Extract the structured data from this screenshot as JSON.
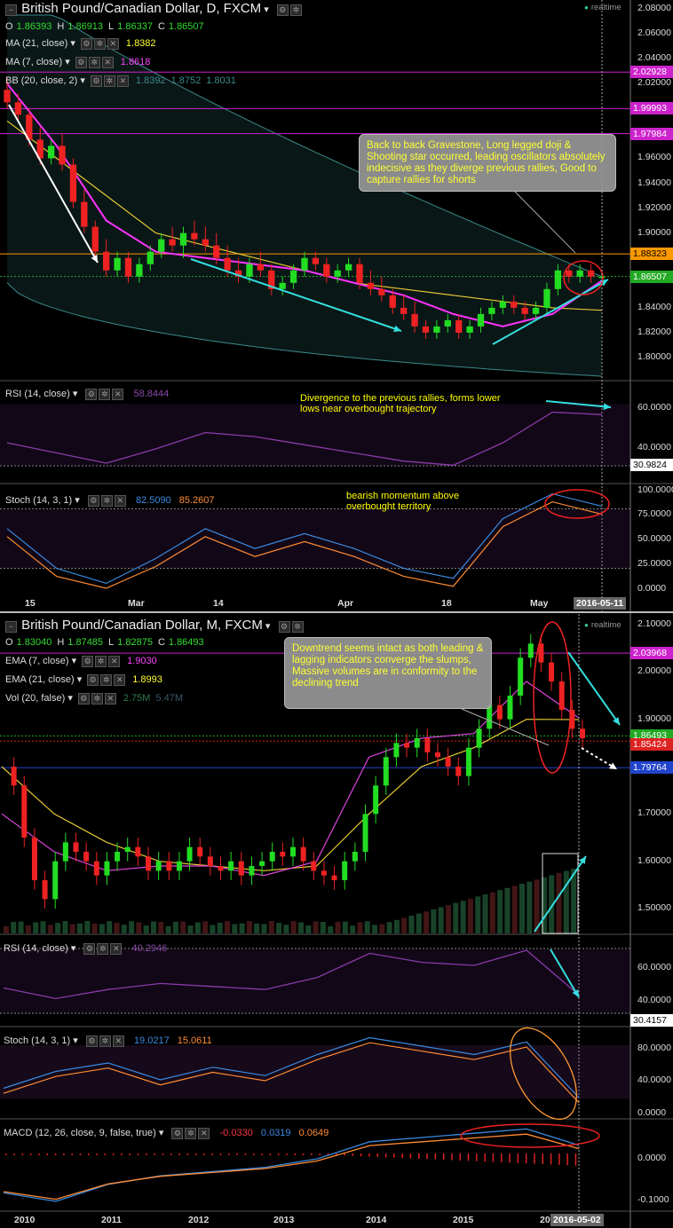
{
  "top": {
    "title": "British Pound/Canadian Dollar, D, FXCM",
    "ohlc": [
      {
        "k": "O",
        "v": "1.86393"
      },
      {
        "k": "H",
        "v": "1.86913"
      },
      {
        "k": "L",
        "v": "1.86337"
      },
      {
        "k": "C",
        "v": "1.86507"
      }
    ],
    "indicators": [
      {
        "label": "MA (21, close)",
        "values": [
          "1.8382"
        ],
        "colors": [
          "#ffff33"
        ]
      },
      {
        "label": "MA (7, close)",
        "values": [
          "1.8618"
        ],
        "colors": [
          "#ff44ff"
        ]
      },
      {
        "label": "BB (20, close, 2)",
        "values": [
          "1.8392",
          "1.8752",
          "1.8031"
        ],
        "colors": [
          "#3a8a8a",
          "#3a8a8a",
          "#3a8a8a"
        ]
      }
    ],
    "realtime": "realtime",
    "callout": "Back to back Gravestone, Long legged doji & Shooting star occurred, leading oscillators absolutely indecisive as they diverge previous rallies, Good to capture rallies for shorts",
    "price_ticks": [
      "2.08000",
      "2.06000",
      "2.04000",
      "2.02000",
      "1.96000",
      "1.94000",
      "1.92000",
      "1.90000",
      "1.84000",
      "1.82000",
      "1.80000"
    ],
    "badges": [
      {
        "text": "2.02928",
        "bg": "#cc22cc",
        "fg": "#ffffff"
      },
      {
        "text": "1.99993",
        "bg": "#cc22cc",
        "fg": "#ffffff"
      },
      {
        "text": "1.97984",
        "bg": "#cc22cc",
        "fg": "#ffffff"
      },
      {
        "text": "1.88323",
        "bg": "#ff9900",
        "fg": "#000000"
      },
      {
        "text": "1.86507",
        "bg": "#22aa22",
        "fg": "#ffffff"
      }
    ],
    "rsi": {
      "label": "RSI (14, close)",
      "value": "58.8444",
      "note": "Divergence to the previous rallies, forms lower lows near overbought trajectory",
      "ticks": [
        "60.0000",
        "40.0000"
      ],
      "badge": "30.9824"
    },
    "stoch": {
      "label": "Stoch (14, 3, 1)",
      "values": [
        "82.5090",
        "85.2607"
      ],
      "note": "bearish momentum above overbought territory",
      "ticks": [
        "100.0000",
        "75.0000",
        "50.0000",
        "25.0000",
        "0.0000"
      ]
    },
    "xaxis": [
      "15",
      "Mar",
      "14",
      "Apr",
      "18",
      "May"
    ],
    "date_badge": "2016-05-11"
  },
  "bottom": {
    "title": "British Pound/Canadian Dollar, M, FXCM",
    "ohlc": [
      {
        "k": "O",
        "v": "1.83040"
      },
      {
        "k": "H",
        "v": "1.87485"
      },
      {
        "k": "L",
        "v": "1.82875"
      },
      {
        "k": "C",
        "v": "1.86493"
      }
    ],
    "indicators": [
      {
        "label": "EMA (7, close)",
        "values": [
          "1.9030"
        ],
        "colors": [
          "#ff44ff"
        ]
      },
      {
        "label": "EMA (21, close)",
        "values": [
          "1.8993"
        ],
        "colors": [
          "#ffff33"
        ]
      },
      {
        "label": "Vol (20, false)",
        "values": [
          "2.75M",
          "5.47M"
        ],
        "colors": [
          "#2e7a4a",
          "#3a5a6a"
        ]
      }
    ],
    "realtime": "realtime",
    "callout": "Downtrend seems intact as both leading & lagging indicators converge the slumps, Massive volumes are in conformity to the declining trend",
    "price_ticks": [
      "2.10000",
      "2.00000",
      "1.90000",
      "1.70000",
      "1.60000",
      "1.50000"
    ],
    "badges": [
      {
        "text": "2.03968",
        "bg": "#cc22cc",
        "fg": "#ffffff"
      },
      {
        "text": "1.86493",
        "bg": "#22aa22",
        "fg": "#ffffff"
      },
      {
        "text": "1.85424",
        "bg": "#dd2222",
        "fg": "#ffffff"
      },
      {
        "text": "1.79764",
        "bg": "#2244cc",
        "fg": "#ffffff"
      }
    ],
    "rsi": {
      "label": "RSI (14, close)",
      "value": "40.2946",
      "ticks": [
        "60.0000",
        "40.0000"
      ],
      "badge": "30.4157"
    },
    "stoch": {
      "label": "Stoch (14, 3, 1)",
      "values": [
        "19.0217",
        "15.0611"
      ],
      "ticks": [
        "80.0000",
        "40.0000",
        "0.0000"
      ]
    },
    "macd": {
      "label": "MACD (12, 26, close, 9, false, true)",
      "values": [
        "-0.0330",
        "0.0319",
        "0.0649"
      ],
      "ticks": [
        "0.0000",
        "-0.1000"
      ]
    },
    "xaxis": [
      "2010",
      "2011",
      "2012",
      "2013",
      "2014",
      "2015",
      "20"
    ],
    "date_badge": "2016-05-02"
  },
  "chart_data": [
    {
      "type": "candlestick",
      "title": "British Pound/Canadian Dollar, D, FXCM",
      "ylim": [
        1.79,
        2.09
      ],
      "x": [
        "15",
        "Mar",
        "14",
        "Apr",
        "18",
        "May"
      ],
      "series": [
        {
          "name": "MA (21, close)",
          "values": [
            1.99,
            1.96,
            1.93,
            1.9,
            1.89,
            1.88,
            1.87,
            1.86,
            1.855,
            1.85,
            1.845,
            1.84,
            1.838
          ]
        },
        {
          "name": "MA (7, close)",
          "values": [
            2.02,
            1.97,
            1.91,
            1.885,
            1.88,
            1.875,
            1.87,
            1.86,
            1.85,
            1.835,
            1.825,
            1.835,
            1.8618
          ]
        },
        {
          "name": "BB (20, close, 2)",
          "values": [
            1.8392,
            1.8752,
            1.8031
          ]
        },
        {
          "name": "RSI (14, close)",
          "values": [
            45,
            40,
            35,
            42,
            50,
            48,
            44,
            40,
            36,
            34,
            45,
            60,
            58.8
          ]
        },
        {
          "name": "Stoch (14, 3, 1)",
          "values": [
            60,
            20,
            5,
            30,
            60,
            40,
            55,
            40,
            20,
            10,
            70,
            95,
            82.5
          ]
        }
      ],
      "candles_ohlc": [
        [
          2.015,
          2.025,
          2.0,
          2.005
        ],
        [
          2.005,
          2.012,
          1.99,
          1.995
        ],
        [
          1.995,
          2.0,
          1.97,
          1.975
        ],
        [
          1.975,
          1.985,
          1.955,
          1.96
        ],
        [
          1.96,
          1.975,
          1.955,
          1.97
        ],
        [
          1.97,
          1.98,
          1.95,
          1.955
        ],
        [
          1.955,
          1.96,
          1.92,
          1.925
        ],
        [
          1.925,
          1.935,
          1.9,
          1.905
        ],
        [
          1.905,
          1.91,
          1.88,
          1.885
        ],
        [
          1.885,
          1.895,
          1.865,
          1.87
        ],
        [
          1.87,
          1.885,
          1.865,
          1.88
        ],
        [
          1.88,
          1.885,
          1.86,
          1.865
        ],
        [
          1.865,
          1.88,
          1.86,
          1.875
        ],
        [
          1.875,
          1.89,
          1.87,
          1.885
        ],
        [
          1.885,
          1.9,
          1.88,
          1.895
        ],
        [
          1.895,
          1.905,
          1.885,
          1.89
        ],
        [
          1.89,
          1.905,
          1.88,
          1.9
        ],
        [
          1.9,
          1.91,
          1.89,
          1.895
        ],
        [
          1.895,
          1.905,
          1.885,
          1.89
        ],
        [
          1.89,
          1.9,
          1.875,
          1.88
        ],
        [
          1.88,
          1.89,
          1.865,
          1.87
        ],
        [
          1.87,
          1.88,
          1.86,
          1.865
        ],
        [
          1.865,
          1.88,
          1.86,
          1.875
        ],
        [
          1.875,
          1.885,
          1.865,
          1.87
        ],
        [
          1.87,
          1.875,
          1.85,
          1.855
        ],
        [
          1.855,
          1.865,
          1.85,
          1.86
        ],
        [
          1.86,
          1.875,
          1.855,
          1.87
        ],
        [
          1.87,
          1.885,
          1.865,
          1.88
        ],
        [
          1.88,
          1.885,
          1.87,
          1.875
        ],
        [
          1.875,
          1.88,
          1.86,
          1.865
        ],
        [
          1.865,
          1.875,
          1.86,
          1.87
        ],
        [
          1.87,
          1.88,
          1.865,
          1.875
        ],
        [
          1.875,
          1.88,
          1.855,
          1.86
        ],
        [
          1.86,
          1.87,
          1.85,
          1.855
        ],
        [
          1.855,
          1.865,
          1.845,
          1.85
        ],
        [
          1.85,
          1.855,
          1.835,
          1.84
        ],
        [
          1.84,
          1.85,
          1.83,
          1.835
        ],
        [
          1.835,
          1.845,
          1.82,
          1.825
        ],
        [
          1.825,
          1.83,
          1.815,
          1.82
        ],
        [
          1.82,
          1.83,
          1.815,
          1.825
        ],
        [
          1.825,
          1.835,
          1.82,
          1.83
        ],
        [
          1.83,
          1.835,
          1.815,
          1.82
        ],
        [
          1.82,
          1.83,
          1.815,
          1.825
        ],
        [
          1.825,
          1.84,
          1.82,
          1.835
        ],
        [
          1.835,
          1.845,
          1.83,
          1.84
        ],
        [
          1.84,
          1.85,
          1.835,
          1.845
        ],
        [
          1.845,
          1.85,
          1.835,
          1.84
        ],
        [
          1.84,
          1.845,
          1.83,
          1.835
        ],
        [
          1.835,
          1.845,
          1.83,
          1.84
        ],
        [
          1.84,
          1.86,
          1.835,
          1.855
        ],
        [
          1.855,
          1.875,
          1.85,
          1.87
        ],
        [
          1.87,
          1.875,
          1.86,
          1.865
        ],
        [
          1.865,
          1.875,
          1.86,
          1.87
        ],
        [
          1.87,
          1.875,
          1.86,
          1.865
        ],
        [
          1.86393,
          1.86913,
          1.86337,
          1.86507
        ]
      ]
    },
    {
      "type": "candlestick",
      "title": "British Pound/Canadian Dollar, M, FXCM",
      "ylim": [
        1.45,
        2.12
      ],
      "x": [
        "2010",
        "2011",
        "2012",
        "2013",
        "2014",
        "2015",
        "20"
      ],
      "series": [
        {
          "name": "EMA (7, close)",
          "values": [
            1.7,
            1.62,
            1.58,
            1.59,
            1.59,
            1.57,
            1.6,
            1.82,
            1.86,
            1.87,
            1.98,
            1.903
          ]
        },
        {
          "name": "EMA (21, close)",
          "values": [
            1.8,
            1.7,
            1.64,
            1.6,
            1.59,
            1.58,
            1.59,
            1.7,
            1.8,
            1.84,
            1.9,
            1.8993
          ]
        },
        {
          "name": "Vol (20, false)",
          "values": [
            2.75,
            5.47
          ]
        },
        {
          "name": "RSI (14, close)",
          "values": [
            45,
            38,
            44,
            48,
            46,
            44,
            52,
            68,
            62,
            60,
            70,
            40.3
          ]
        },
        {
          "name": "Stoch (14, 3, 1)",
          "values": [
            30,
            50,
            60,
            40,
            55,
            45,
            70,
            90,
            80,
            70,
            85,
            19.0
          ]
        },
        {
          "name": "MACD (12, 26, close, 9, false, true)",
          "values": [
            -0.08,
            -0.1,
            -0.06,
            -0.04,
            -0.03,
            -0.02,
            0.0,
            0.04,
            0.05,
            0.06,
            0.07,
            0.0319
          ]
        }
      ]
    }
  ]
}
